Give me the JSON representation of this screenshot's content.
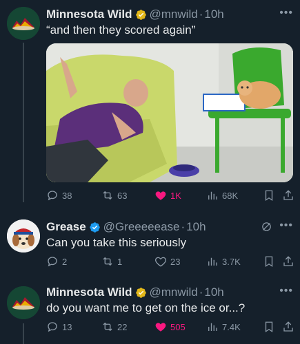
{
  "tweets": [
    {
      "author": "Minnesota Wild",
      "handle": "@mnwild",
      "separator": "·",
      "time": "10h",
      "text": "“and then they scored again”",
      "stats": {
        "replies": "38",
        "retweets": "63",
        "likes": "1K",
        "views": "68K"
      },
      "liked": true
    },
    {
      "author": "Grease",
      "handle": "@Greeeeease",
      "separator": "·",
      "time": "10h",
      "text": "Can you take this seriously",
      "stats": {
        "replies": "2",
        "retweets": "1",
        "likes": "23",
        "views": "3.7K"
      },
      "liked": false
    },
    {
      "author": "Minnesota Wild",
      "handle": "@mnwild",
      "separator": "·",
      "time": "10h",
      "text": "do you want me to get on the ice or...?",
      "stats": {
        "replies": "13",
        "retweets": "22",
        "likes": "505",
        "views": "7.4K"
      },
      "liked": true
    }
  ],
  "more_label": "•••",
  "colors": {
    "background": "#15202b",
    "like": "#f91880",
    "muted": "#8b98a5",
    "verified_gold": "#e2b719",
    "verified_blue": "#1d9bf0",
    "wild_green": "#154734"
  },
  "icons": [
    "reply-icon",
    "retweet-icon",
    "heart-icon",
    "views-icon",
    "bookmark-icon",
    "share-icon",
    "more-icon",
    "grok-icon"
  ]
}
